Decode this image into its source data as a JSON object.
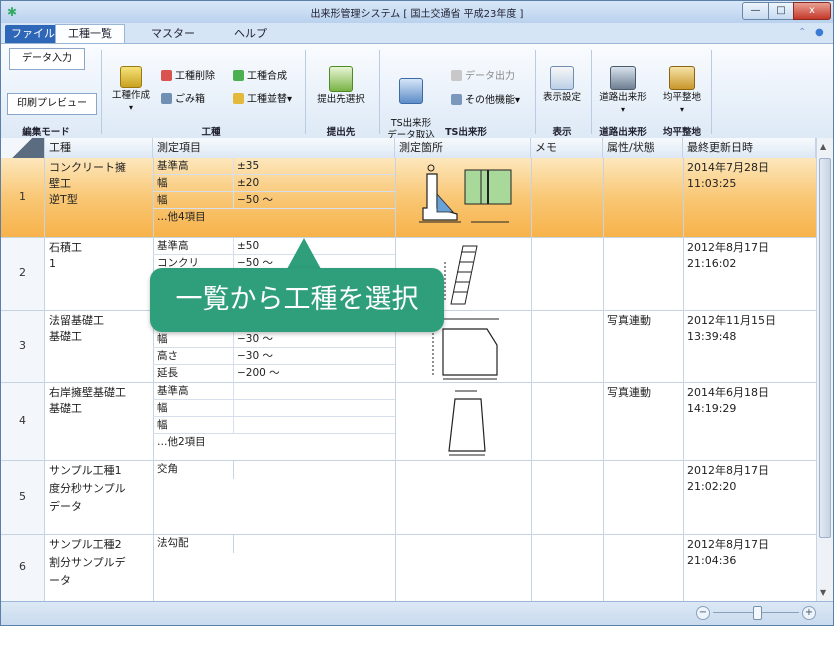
{
  "window": {
    "title": "出来形管理システム [ 国土交通省 平成23年度 ]",
    "controls": {
      "minimize": "—",
      "maximize": "□",
      "close": "x"
    }
  },
  "menu_tabs": [
    {
      "label": "ファイル"
    },
    {
      "label": "工種一覧"
    },
    {
      "label": "マスター"
    },
    {
      "label": "ヘルプ"
    }
  ],
  "ribbon_ctrl": {
    "up": "⌃",
    "help": "●"
  },
  "ribbon": {
    "data_input": "データ入力",
    "print_preview": "印刷プレビュー",
    "edit_mode_label": "編集モード",
    "create_worktype": "工種作成",
    "delete_worktype": "工種削除",
    "trash": "ごみ箱",
    "combine_worktype": "工種合成",
    "sort_worktype": "工種並替",
    "worktype_label": "工種",
    "select_destination": "提出先選択",
    "destination_label": "提出先",
    "ts_import": "TS出来形\nデータ取込",
    "data_output": "データ出力",
    "other_functions": "その他機能",
    "ts_label": "TS出来形",
    "display_settings": "表示設定",
    "display_label": "表示",
    "road_dekigata": "道路出来形",
    "road_label": "道路出来形",
    "leveling": "均平整地",
    "leveling_label": "均平整地",
    "dropdown_arrow": "▾"
  },
  "grid": {
    "headers": [
      "工種",
      "測定項目",
      "測定箇所",
      "メモ",
      "属性/状態",
      "最終更新日時"
    ],
    "rows": [
      {
        "num": "1",
        "worktype": [
          "コンクリート擁",
          "壁工",
          "逆T型"
        ],
        "items": [
          {
            "name": "基準高",
            "value": "±35"
          },
          {
            "name": "幅",
            "value": "±20"
          },
          {
            "name": "幅",
            "value": "−50 ～"
          },
          {
            "name": "…他4項目",
            "value": ""
          }
        ],
        "status": "",
        "date": "2014年7月28日",
        "time": "11:03:25"
      },
      {
        "num": "2",
        "worktype": [
          "石積工",
          "1"
        ],
        "items": [
          {
            "name": "基準高",
            "value": "±50"
          },
          {
            "name": "コンクリ",
            "value": "−50 ～"
          }
        ],
        "status": "",
        "date": "2012年8月17日",
        "time": "21:16:02"
      },
      {
        "num": "3",
        "worktype": [
          "法留基礎工",
          "基礎工"
        ],
        "items": [
          {
            "name": "幅",
            "value": "−30 ～"
          },
          {
            "name": "高さ",
            "value": "−30 ～"
          },
          {
            "name": "延長",
            "value": "−200 ～"
          }
        ],
        "status": "写真連動",
        "date": "2012年11月15日",
        "time": "13:39:48"
      },
      {
        "num": "4",
        "worktype": [
          "右岸擁壁基礎工",
          "基礎工"
        ],
        "items": [
          {
            "name": "基準高",
            "value": ""
          },
          {
            "name": "幅",
            "value": ""
          },
          {
            "name": "幅",
            "value": ""
          },
          {
            "name": "…他2項目",
            "value": ""
          }
        ],
        "status": "写真連動",
        "date": "2014年6月18日",
        "time": "14:19:29"
      },
      {
        "num": "5",
        "worktype": [
          "サンプル工種1",
          "度分秒サンプル",
          "データ"
        ],
        "items": [
          {
            "name": "交角",
            "value": ""
          }
        ],
        "status": "",
        "date": "2012年8月17日",
        "time": "21:02:20"
      },
      {
        "num": "6",
        "worktype": [
          "サンプル工種2",
          "割分サンプルデ",
          "ータ"
        ],
        "items": [
          {
            "name": "法勾配",
            "value": ""
          }
        ],
        "status": "",
        "date": "2012年8月17日",
        "time": "21:04:36"
      }
    ]
  },
  "statusbar": {
    "zoom_minus": "−",
    "zoom_plus": "+"
  },
  "callout": {
    "text": "一覧から工種を選択"
  },
  "colors": {
    "selected_row": "#f9c775",
    "callout": "#2f9e7a",
    "file_tab": "#2e66b8"
  }
}
